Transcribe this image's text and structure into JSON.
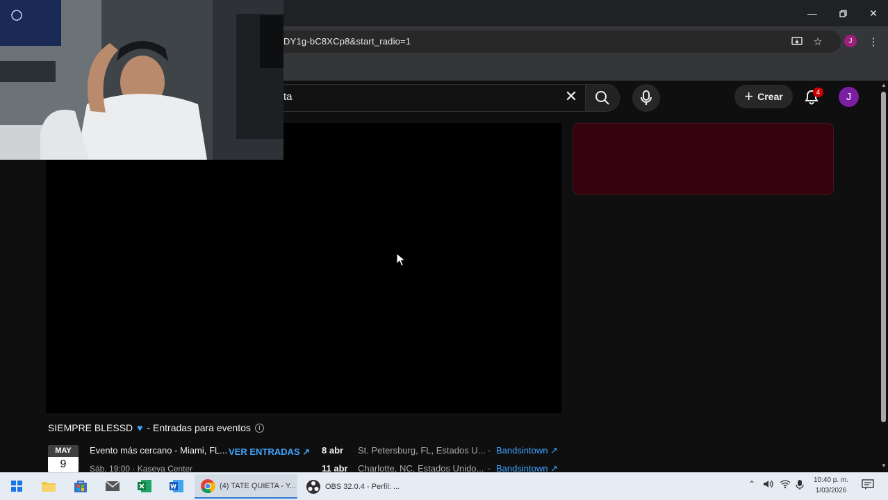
{
  "browser": {
    "url_partial": "DY1g-bC8XCp8&start_radio=1",
    "profile_initial": "J",
    "window_controls": [
      "minimize",
      "restore",
      "close"
    ]
  },
  "youtube": {
    "search_query_visible": "ta",
    "create_label": "Crear",
    "notification_count": "4",
    "avatar_initial": "J"
  },
  "events": {
    "title": "SIEMPRE BLESSD",
    "title_suffix": "- Entradas para eventos",
    "featured": {
      "month": "MAY",
      "day": "9",
      "main": "Evento más cercano - Miami, FL...",
      "cta": "VER ENTRADAS",
      "sub": "Sáb, 19:00 · Kaseya Center"
    },
    "rows": [
      {
        "date": "8 abr",
        "place": "St. Petersburg, FL, Estados U...",
        "source": "Bandsintown"
      },
      {
        "date": "11 abr",
        "place": "Charlotte, NC, Estados Unido...",
        "source": "Bandsintown"
      }
    ]
  },
  "taskbar": {
    "chrome_task": "(4) TATE QUIETA - Y...",
    "obs_task": "OBS 32.0.4 - Perfil: ...",
    "time": "10:40 p. m.",
    "date": "1/03/2026"
  },
  "colors": {
    "accent_blue": "#3ea6ff",
    "side_panel": "#34030e",
    "avatar": "#7a1fa2"
  }
}
